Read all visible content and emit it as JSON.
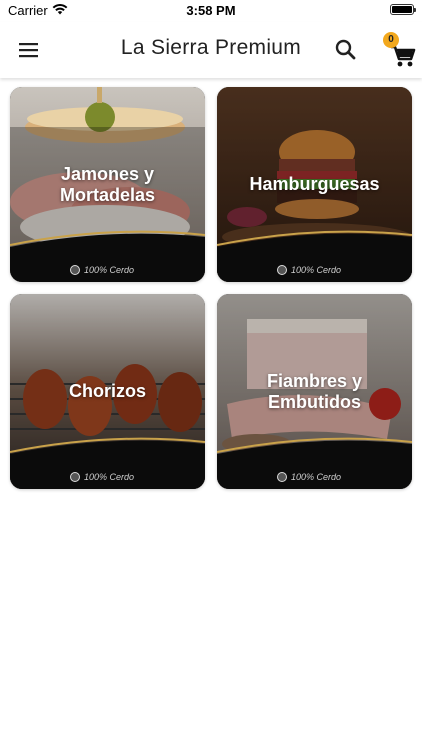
{
  "status_bar": {
    "carrier": "Carrier",
    "time": "3:58 PM"
  },
  "app_bar": {
    "title": "La Sierra Premium",
    "cart_count": "0"
  },
  "categories": [
    {
      "label": "Jamones y Mortadelas",
      "badge": "100% Cerdo"
    },
    {
      "label": "Hamburguesas",
      "badge": "100% Cerdo"
    },
    {
      "label": "Chorizos",
      "badge": "100% Cerdo"
    },
    {
      "label": "Fiambres y Embutidos",
      "badge": "100% Cerdo"
    }
  ],
  "colors": {
    "badge_orange": "#f2a81d",
    "gold_ribbon": "#c9a24a"
  },
  "icons": {
    "menu": "hamburger-menu-icon",
    "search": "search-icon",
    "cart": "shopping-cart-icon"
  }
}
